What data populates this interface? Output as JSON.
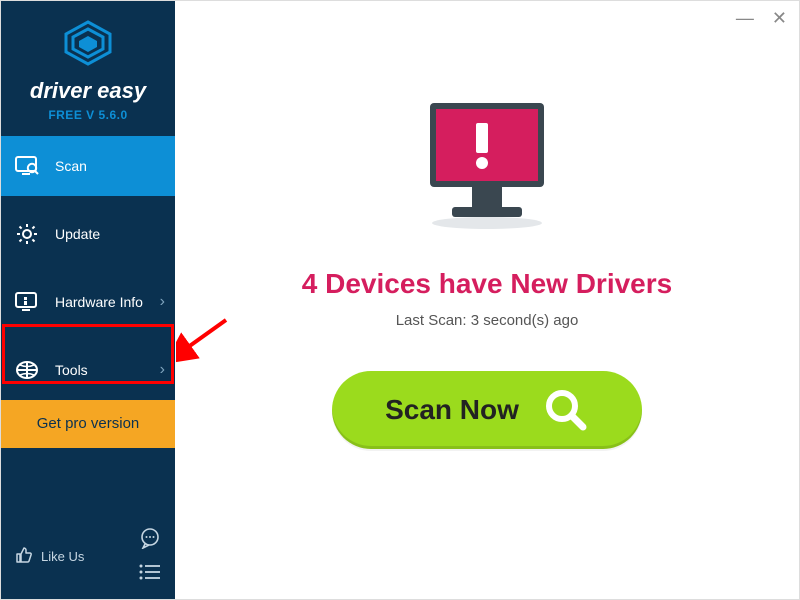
{
  "brand": {
    "name": "driver easy",
    "version": "FREE V 5.6.0"
  },
  "sidebar": {
    "items": [
      {
        "label": "Scan"
      },
      {
        "label": "Update"
      },
      {
        "label": "Hardware Info"
      },
      {
        "label": "Tools"
      }
    ],
    "get_pro": "Get pro version",
    "like_us": "Like Us"
  },
  "main": {
    "headline": "4 Devices have New Drivers",
    "subline": "Last Scan: 3 second(s) ago",
    "scan_button": "Scan Now"
  },
  "window": {
    "minimize": "—",
    "close": "✕"
  }
}
